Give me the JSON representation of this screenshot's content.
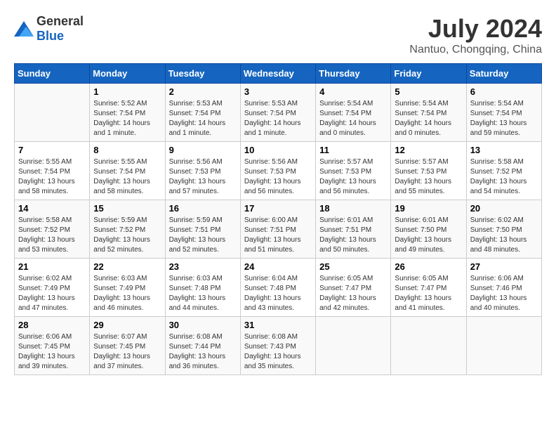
{
  "header": {
    "logo_general": "General",
    "logo_blue": "Blue",
    "month_year": "July 2024",
    "location": "Nantuo, Chongqing, China"
  },
  "days_of_week": [
    "Sunday",
    "Monday",
    "Tuesday",
    "Wednesday",
    "Thursday",
    "Friday",
    "Saturday"
  ],
  "weeks": [
    [
      {
        "day": "",
        "empty": true
      },
      {
        "day": "1",
        "sunrise": "Sunrise: 5:52 AM",
        "sunset": "Sunset: 7:54 PM",
        "daylight": "Daylight: 14 hours and 1 minute."
      },
      {
        "day": "2",
        "sunrise": "Sunrise: 5:53 AM",
        "sunset": "Sunset: 7:54 PM",
        "daylight": "Daylight: 14 hours and 1 minute."
      },
      {
        "day": "3",
        "sunrise": "Sunrise: 5:53 AM",
        "sunset": "Sunset: 7:54 PM",
        "daylight": "Daylight: 14 hours and 1 minute."
      },
      {
        "day": "4",
        "sunrise": "Sunrise: 5:54 AM",
        "sunset": "Sunset: 7:54 PM",
        "daylight": "Daylight: 14 hours and 0 minutes."
      },
      {
        "day": "5",
        "sunrise": "Sunrise: 5:54 AM",
        "sunset": "Sunset: 7:54 PM",
        "daylight": "Daylight: 14 hours and 0 minutes."
      },
      {
        "day": "6",
        "sunrise": "Sunrise: 5:54 AM",
        "sunset": "Sunset: 7:54 PM",
        "daylight": "Daylight: 13 hours and 59 minutes."
      }
    ],
    [
      {
        "day": "7",
        "sunrise": "Sunrise: 5:55 AM",
        "sunset": "Sunset: 7:54 PM",
        "daylight": "Daylight: 13 hours and 58 minutes."
      },
      {
        "day": "8",
        "sunrise": "Sunrise: 5:55 AM",
        "sunset": "Sunset: 7:54 PM",
        "daylight": "Daylight: 13 hours and 58 minutes."
      },
      {
        "day": "9",
        "sunrise": "Sunrise: 5:56 AM",
        "sunset": "Sunset: 7:53 PM",
        "daylight": "Daylight: 13 hours and 57 minutes."
      },
      {
        "day": "10",
        "sunrise": "Sunrise: 5:56 AM",
        "sunset": "Sunset: 7:53 PM",
        "daylight": "Daylight: 13 hours and 56 minutes."
      },
      {
        "day": "11",
        "sunrise": "Sunrise: 5:57 AM",
        "sunset": "Sunset: 7:53 PM",
        "daylight": "Daylight: 13 hours and 56 minutes."
      },
      {
        "day": "12",
        "sunrise": "Sunrise: 5:57 AM",
        "sunset": "Sunset: 7:53 PM",
        "daylight": "Daylight: 13 hours and 55 minutes."
      },
      {
        "day": "13",
        "sunrise": "Sunrise: 5:58 AM",
        "sunset": "Sunset: 7:52 PM",
        "daylight": "Daylight: 13 hours and 54 minutes."
      }
    ],
    [
      {
        "day": "14",
        "sunrise": "Sunrise: 5:58 AM",
        "sunset": "Sunset: 7:52 PM",
        "daylight": "Daylight: 13 hours and 53 minutes."
      },
      {
        "day": "15",
        "sunrise": "Sunrise: 5:59 AM",
        "sunset": "Sunset: 7:52 PM",
        "daylight": "Daylight: 13 hours and 52 minutes."
      },
      {
        "day": "16",
        "sunrise": "Sunrise: 5:59 AM",
        "sunset": "Sunset: 7:51 PM",
        "daylight": "Daylight: 13 hours and 52 minutes."
      },
      {
        "day": "17",
        "sunrise": "Sunrise: 6:00 AM",
        "sunset": "Sunset: 7:51 PM",
        "daylight": "Daylight: 13 hours and 51 minutes."
      },
      {
        "day": "18",
        "sunrise": "Sunrise: 6:01 AM",
        "sunset": "Sunset: 7:51 PM",
        "daylight": "Daylight: 13 hours and 50 minutes."
      },
      {
        "day": "19",
        "sunrise": "Sunrise: 6:01 AM",
        "sunset": "Sunset: 7:50 PM",
        "daylight": "Daylight: 13 hours and 49 minutes."
      },
      {
        "day": "20",
        "sunrise": "Sunrise: 6:02 AM",
        "sunset": "Sunset: 7:50 PM",
        "daylight": "Daylight: 13 hours and 48 minutes."
      }
    ],
    [
      {
        "day": "21",
        "sunrise": "Sunrise: 6:02 AM",
        "sunset": "Sunset: 7:49 PM",
        "daylight": "Daylight: 13 hours and 47 minutes."
      },
      {
        "day": "22",
        "sunrise": "Sunrise: 6:03 AM",
        "sunset": "Sunset: 7:49 PM",
        "daylight": "Daylight: 13 hours and 46 minutes."
      },
      {
        "day": "23",
        "sunrise": "Sunrise: 6:03 AM",
        "sunset": "Sunset: 7:48 PM",
        "daylight": "Daylight: 13 hours and 44 minutes."
      },
      {
        "day": "24",
        "sunrise": "Sunrise: 6:04 AM",
        "sunset": "Sunset: 7:48 PM",
        "daylight": "Daylight: 13 hours and 43 minutes."
      },
      {
        "day": "25",
        "sunrise": "Sunrise: 6:05 AM",
        "sunset": "Sunset: 7:47 PM",
        "daylight": "Daylight: 13 hours and 42 minutes."
      },
      {
        "day": "26",
        "sunrise": "Sunrise: 6:05 AM",
        "sunset": "Sunset: 7:47 PM",
        "daylight": "Daylight: 13 hours and 41 minutes."
      },
      {
        "day": "27",
        "sunrise": "Sunrise: 6:06 AM",
        "sunset": "Sunset: 7:46 PM",
        "daylight": "Daylight: 13 hours and 40 minutes."
      }
    ],
    [
      {
        "day": "28",
        "sunrise": "Sunrise: 6:06 AM",
        "sunset": "Sunset: 7:45 PM",
        "daylight": "Daylight: 13 hours and 39 minutes."
      },
      {
        "day": "29",
        "sunrise": "Sunrise: 6:07 AM",
        "sunset": "Sunset: 7:45 PM",
        "daylight": "Daylight: 13 hours and 37 minutes."
      },
      {
        "day": "30",
        "sunrise": "Sunrise: 6:08 AM",
        "sunset": "Sunset: 7:44 PM",
        "daylight": "Daylight: 13 hours and 36 minutes."
      },
      {
        "day": "31",
        "sunrise": "Sunrise: 6:08 AM",
        "sunset": "Sunset: 7:43 PM",
        "daylight": "Daylight: 13 hours and 35 minutes."
      },
      {
        "day": "",
        "empty": true
      },
      {
        "day": "",
        "empty": true
      },
      {
        "day": "",
        "empty": true
      }
    ]
  ]
}
